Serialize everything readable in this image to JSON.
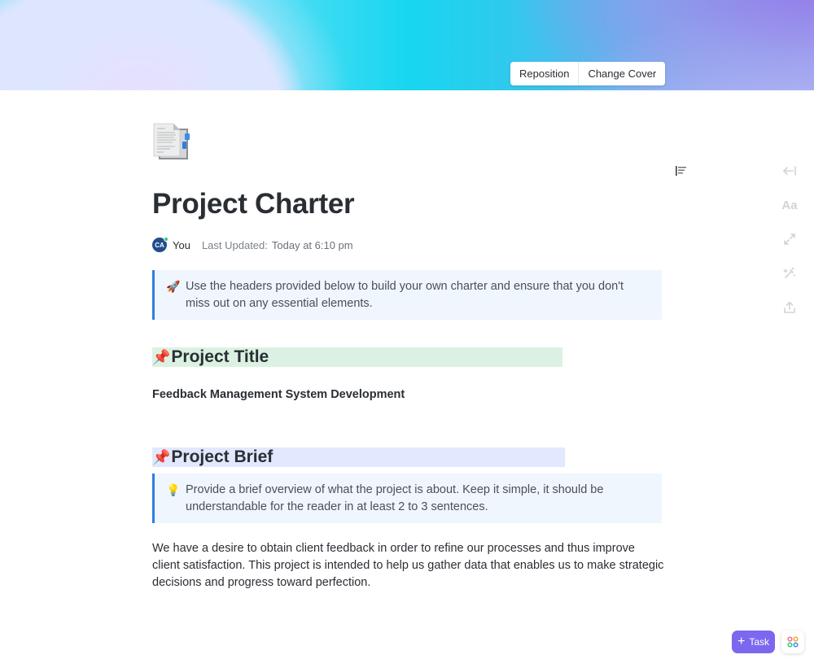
{
  "cover": {
    "reposition_label": "Reposition",
    "change_cover_label": "Change Cover"
  },
  "document": {
    "icon": "document-icon",
    "title": "Project Charter",
    "meta": {
      "avatar_initials": "CA",
      "author": "You",
      "last_updated_label": "Last Updated:",
      "last_updated_value": "Today at 6:10 pm"
    },
    "callout_intro": {
      "emoji": "🚀",
      "text": "Use the headers provided below to build your own charter and ensure that you don't miss out on any essential elements."
    },
    "sections": [
      {
        "emoji": "📌",
        "heading": "Project Title",
        "highlight_color": "#dbf2e2",
        "content": "Feedback Management System Development"
      },
      {
        "emoji": "📌",
        "heading": "Project Brief",
        "highlight_color": "#e2e8fd",
        "callout": {
          "emoji": "💡",
          "text": "Provide a brief overview of what the project is about. Keep it simple, it should be understandable for the reader in at least 2 to 3 sentences."
        },
        "content": "We have a desire to obtain client feedback in order to refine our processes and thus improve client satisfaction. This project is intended to help us gather data that enables us to make strategic decisions and progress toward perfection."
      }
    ]
  },
  "right_rail": {
    "items": [
      {
        "icon": "collapse-arrow-icon"
      },
      {
        "icon": "typography-icon",
        "label": "Aa"
      },
      {
        "icon": "expand-arrows-icon"
      },
      {
        "icon": "magic-wand-icon"
      },
      {
        "icon": "share-upload-icon"
      }
    ]
  },
  "floating": {
    "task_label": "Task",
    "apps_icon": "apps-grid-icon"
  },
  "colors": {
    "accent": "#7b68ee",
    "callout_border": "#2d7fe0",
    "callout_bg": "#f0f6fe",
    "avatar_bg": "#1f4e8c",
    "online": "#2ecc71"
  }
}
